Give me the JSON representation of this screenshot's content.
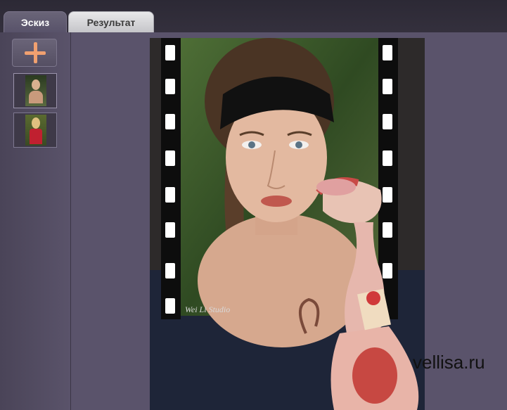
{
  "tabs": [
    {
      "label": "Эскиз",
      "active": true
    },
    {
      "label": "Результат",
      "active": false
    }
  ],
  "sidebar": {
    "add_button": {
      "icon": "plus-icon",
      "color": "#f0a070"
    },
    "thumbnails": [
      {
        "icon": "photo-thumbnail",
        "selected": true
      },
      {
        "icon": "photo-thumbnail",
        "selected": false
      }
    ]
  },
  "watermark": "vellisa.ru",
  "colors": {
    "workspace_bg": "#5a536b",
    "accent": "#f0a070"
  }
}
